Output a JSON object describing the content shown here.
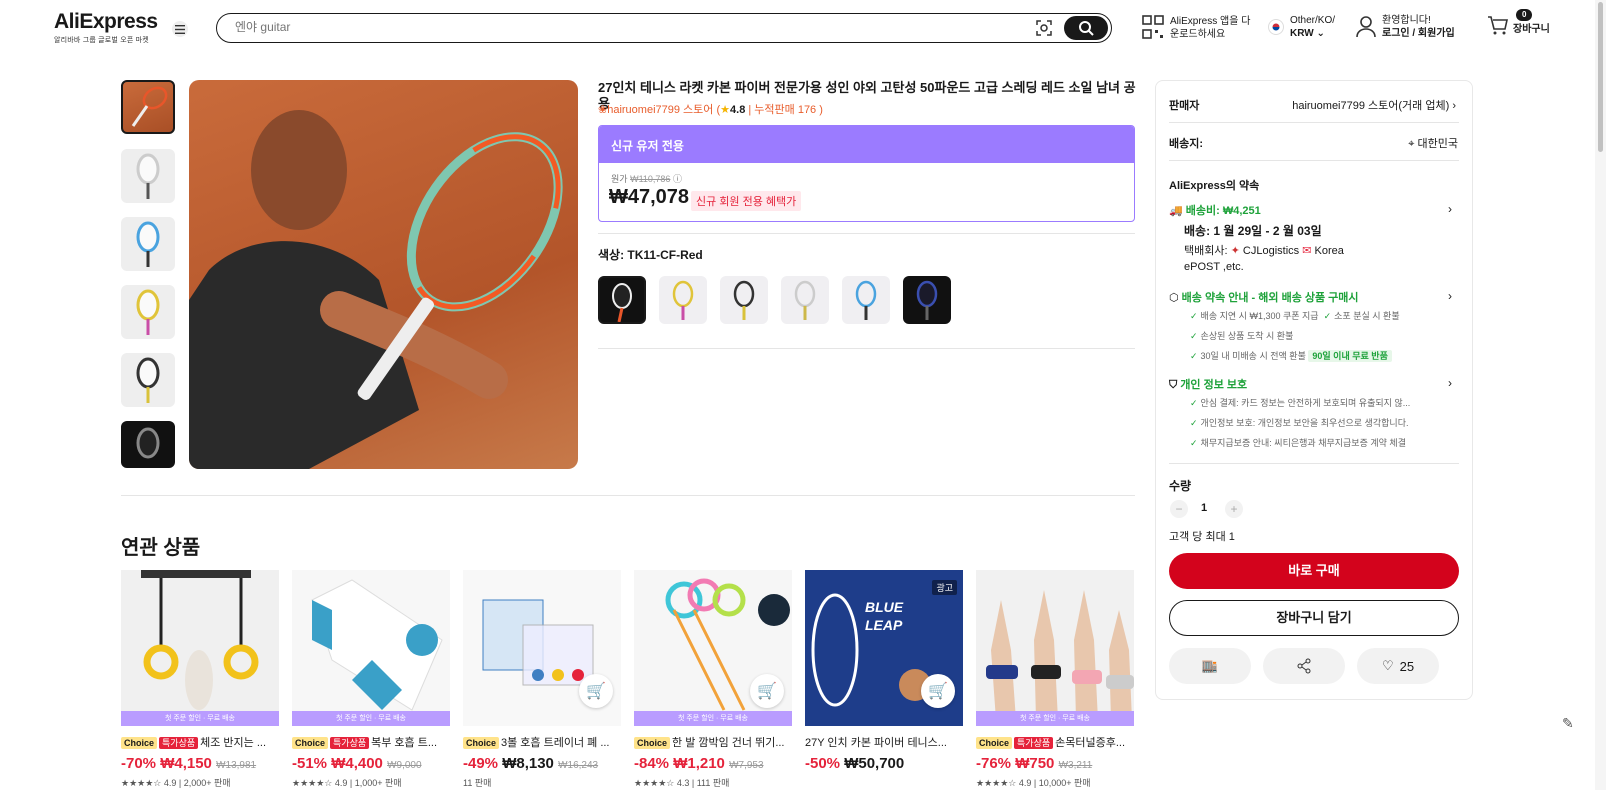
{
  "header": {
    "logo": "AliExpress",
    "logo_sub": "알리바바 그룹 글로벌 오픈 마켓",
    "search_placeholder": "엔야 guitar",
    "app_line1": "AliExpress 앱을 다",
    "app_line2": "운로드하세요",
    "region_line1": "Other/KO/",
    "region_line2": "KRW",
    "account_line1": "환영합니다!",
    "account_line2": "로그인 / 회원가입",
    "cart_count": "0",
    "cart_label": "장바구니"
  },
  "product": {
    "title": "27인치 테니스 라켓 카본 파이버 전문가용 성인 야외 고탄성 50파운드 고급 스레딩 레드 소일 남녀 공용",
    "store": "hairuomei7799 스토어 (",
    "rating": "4.8",
    "sold": "| 누적판매 176 )",
    "promo_header": "신규 유저 전용",
    "orig_label": "원가",
    "orig_price": "₩110,786",
    "price": "₩47,078",
    "price_badge": "신규 회원 전용 혜택가",
    "color_label": "색상: TK11-CF-Red"
  },
  "related": {
    "title": "연관 상품",
    "strip_text": "첫 주문 할인 · 무료 배송",
    "ad_label": "광고",
    "items": [
      {
        "tag1": "Choice",
        "tag2": "특가상품",
        "name": "체조 반지는 ...",
        "disc": "-70%",
        "price": "₩4,150",
        "orig": "₩13,981",
        "meta": "★★★★☆ 4.9 | 2,000+ 판매"
      },
      {
        "tag1": "Choice",
        "tag2": "특가상품",
        "name": "복부 호흡 트...",
        "disc": "-51%",
        "price": "₩4,400",
        "orig": "₩9,000",
        "meta": "★★★★☆ 4.9 | 1,000+ 판매"
      },
      {
        "tag1": "Choice",
        "tag2": "",
        "name": "3볼 호흡 트레이너 폐 ...",
        "disc": "-49%",
        "price": "₩8,130",
        "orig": "₩16,243",
        "meta": "11 판매"
      },
      {
        "tag1": "Choice",
        "tag2": "",
        "name": "한 발 깜박임 건너 뛰기...",
        "disc": "-84%",
        "price": "₩1,210",
        "orig": "₩7,953",
        "meta": "★★★★☆ 4.3 | 111 판매"
      },
      {
        "tag1": "",
        "tag2": "",
        "name": "27Y 인치 카본 파이버 테니스...",
        "disc": "-50%",
        "price": "₩50,700",
        "orig": "",
        "meta": ""
      },
      {
        "tag1": "Choice",
        "tag2": "특가상품",
        "name": "손목터널증후...",
        "disc": "-76%",
        "price": "₩750",
        "orig": "₩3,211",
        "meta": "★★★★☆ 4.9 | 10,000+ 판매"
      }
    ]
  },
  "panel": {
    "seller_label": "판매자",
    "seller_value": "hairuomei7799 스토어(거래 업체)",
    "ship_to_label": "배송지:",
    "ship_to_value": "대한민국",
    "promise_title": "AliExpress의 약속",
    "shipping_fee": "배송비: ₩4,251",
    "delivery": "배송: 1 월 29일 - 2 월 03일",
    "courier_label": "택배회사:",
    "courier1": "CJLogistics",
    "courier2": "Korea",
    "courier3": "ePOST ,etc.",
    "guarantee_title": "배송 약속 안내 - 해외 배송 상품 구매시",
    "g1": "배송 지연 시 ₩1,300 쿠폰 지급",
    "g2": "소포 분실 시 환불",
    "g3": "손상된 상품 도착 시 환불",
    "g4": "30일 내 미배송 시 전액 환불",
    "g4_pill": "90일 이내 무료 반품",
    "privacy_title": "개인 정보 보호",
    "p1": "안심 결제: 카드 정보는 안전하게 보호되며 유출되지 않...",
    "p2": "개인정보 보호: 개인정보 보안을 최우선으로 생각합니다.",
    "p3": "채무지급보증 안내: 씨티은행과 채무지급보증 계약 체결",
    "qty_label": "수량",
    "qty_value": "1",
    "qty_limit": "고객 당 최대 1",
    "buy_now": "바로 구매",
    "add_cart": "장바구니 담기",
    "wish_count": "25"
  },
  "colors": {
    "accent_red": "#d3031c",
    "promo_purple": "#9b7bff",
    "green": "#1ea23a"
  }
}
